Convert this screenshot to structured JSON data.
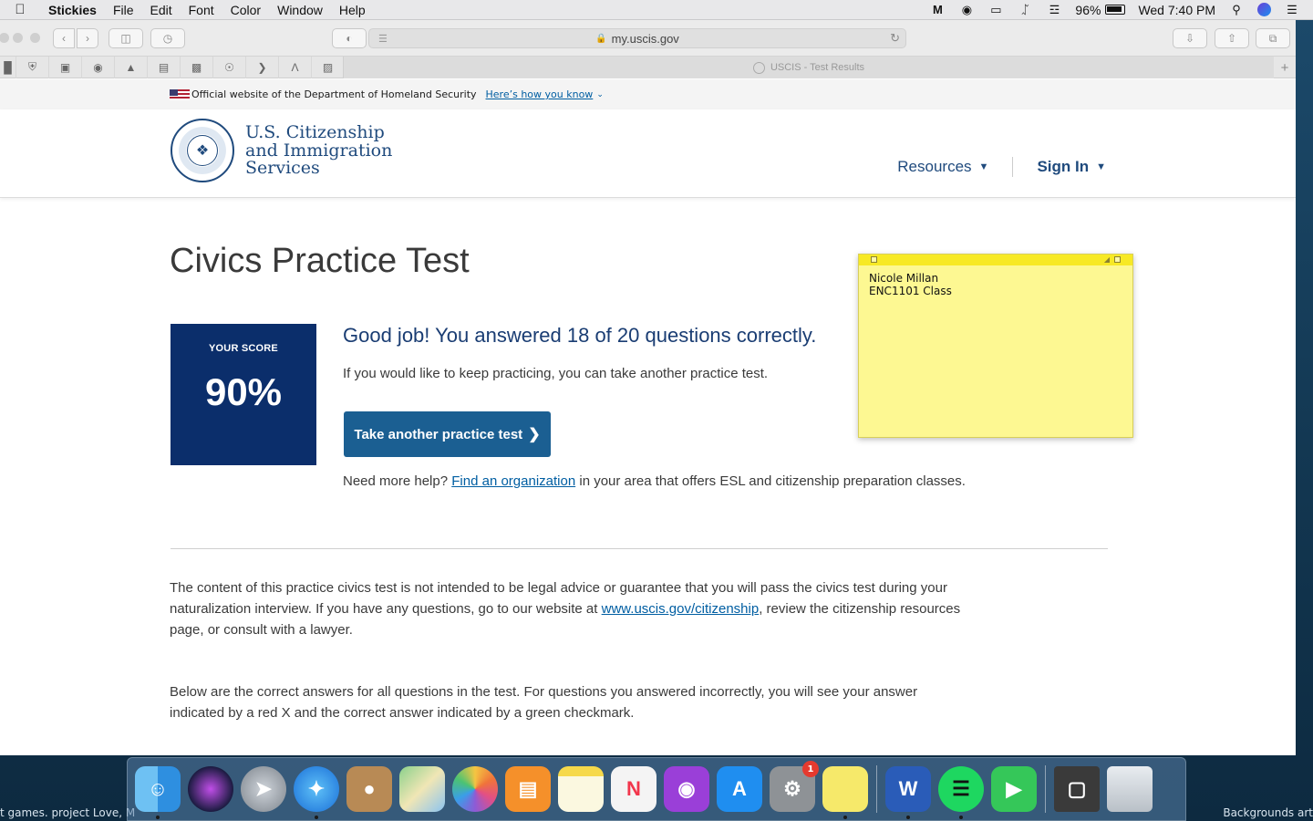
{
  "menubar": {
    "app": "Stickies",
    "items": [
      "File",
      "Edit",
      "Font",
      "Color",
      "Window",
      "Help"
    ],
    "battery": "96%",
    "clock": "Wed 7:40 PM"
  },
  "browser": {
    "url": "my.uscis.gov",
    "tab_title": "USCIS - Test Results"
  },
  "banner": {
    "text": "Official website of the Department of Homeland Security",
    "link": "Here’s how you know"
  },
  "header": {
    "org_line1": "U.S. Citizenship",
    "org_line2": "and Immigration",
    "org_line3": "Services",
    "nav": [
      "Resources",
      "Sign In"
    ]
  },
  "main": {
    "title": "Civics Practice Test",
    "score_label": "YOUR SCORE",
    "score_value": "90%",
    "result_heading": "Good job! You answered 18 of 20 questions correctly.",
    "result_sub": "If you would like to keep practicing, you can take another practice test.",
    "cta_label": "Take another practice test",
    "help_prefix": "Need more help? ",
    "help_link": "Find an organization",
    "help_suffix": " in your area that offers ESL and citizenship preparation classes.",
    "para1_a": "The content of this practice civics test is not intended to be legal advice or guarantee that you will pass the civics test during your naturalization interview. If you have any questions, go to our website at ",
    "para1_link": "www.uscis.gov/citizenship",
    "para1_b": ", review the citizenship resources page, or consult with a lawyer.",
    "para2": "Below are the correct answers for all questions in the test. For questions you answered incorrectly, you will see your answer indicated by a red X and the correct answer indicated by a green checkmark."
  },
  "sticky": {
    "line1": "Nicole Millan",
    "line2": "ENC1101 Class"
  },
  "desktop": {
    "left_text": "t games. project Love, M",
    "right_text": "Backgrounds art"
  },
  "dock": {
    "settings_badge": "1",
    "apps": [
      "finder",
      "siri",
      "launchpad",
      "safari",
      "contacts",
      "maps",
      "photos",
      "books",
      "notes",
      "news",
      "podcasts",
      "app-store",
      "system-preferences",
      "stickies",
      "word",
      "spotify",
      "facetime",
      "screenshot",
      "trash"
    ]
  }
}
